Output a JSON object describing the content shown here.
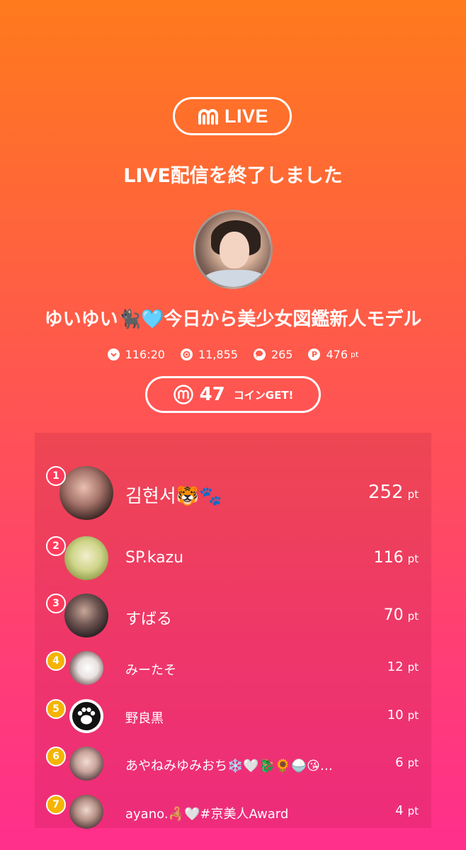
{
  "header": {
    "logo_text": "LIVE",
    "ended_title": "LIVE配信を終了しました"
  },
  "host": {
    "name": "ゆいゆい🐈‍⬛🩵今日から美少女図鑑新人モデル"
  },
  "stats": {
    "duration": "116:20",
    "viewers": "11,855",
    "comments": "265",
    "points": "476",
    "points_unit": "pt"
  },
  "coins": {
    "count": "47",
    "label": "コインGET!"
  },
  "ranking": [
    {
      "rank": "1",
      "name": "김현서🐯🐾",
      "points": "252",
      "unit": "pt"
    },
    {
      "rank": "2",
      "name": "SP.kazu",
      "points": "116",
      "unit": "pt"
    },
    {
      "rank": "3",
      "name": "すばる",
      "points": "70",
      "unit": "pt"
    },
    {
      "rank": "4",
      "name": "みーたそ",
      "points": "12",
      "unit": "pt"
    },
    {
      "rank": "5",
      "name": "野良黒",
      "points": "10",
      "unit": "pt"
    },
    {
      "rank": "6",
      "name": "あやねみゆみおち❄️🤍🐉🌻🍚😘…",
      "points": "6",
      "unit": "pt"
    },
    {
      "rank": "7",
      "name": "ayano.🦂🤍#京美人Award",
      "points": "4",
      "unit": "pt"
    }
  ],
  "colors": {
    "gold": "#f5b400",
    "red": "#ff3b5c",
    "gradient_top": "#ff7a1c",
    "gradient_bottom": "#ff2f8c"
  }
}
